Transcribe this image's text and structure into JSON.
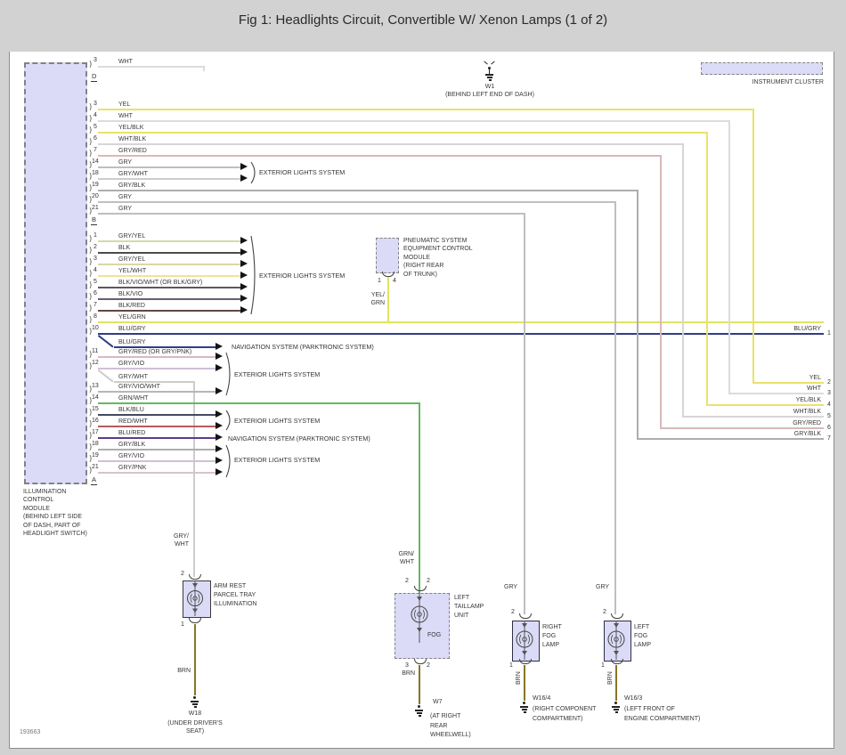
{
  "title": "Fig 1: Headlights Circuit, Convertible W/ Xenon Lamps (1 of 2)",
  "doc_id": "193663",
  "colors": {
    "page_bg": "#d2d2d2",
    "canvas": "#ffffff",
    "module_fill": "#dbdbf7",
    "YEL": "#e9e26b",
    "WHT": "#dcdcdc",
    "YEL_BLK": "#e9e26b",
    "WHT_BLK": "#d6d6d6",
    "GRY_RED": "#d8b9b9",
    "GRY": "#bfbfbf",
    "GRY_WHT": "#cdcdcd",
    "GRY_BLK": "#aeaeae",
    "GRY_YEL": "#d8d8a8",
    "BLK": "#4c4c4c",
    "YEL_WHT": "#ece594",
    "BLK_VIO_WHT": "#5d5663",
    "BLK_VIO": "#6d5c73",
    "BLK_RED": "#614747",
    "YEL_GRN": "#dfe55e",
    "BLU_GRY": "#303d85",
    "GRY_VIO": "#cfc0d6",
    "GRY_VIO_WHT": "#b6b6be",
    "GRN_WHT": "#63b863",
    "BLK_BLU": "#424a5e",
    "RED_WHT": "#b65b5b",
    "BLU_RED": "#5c3b8e",
    "GRY_PNK": "#d9c3cb",
    "BRN": "#8a7426"
  },
  "left_module": {
    "caption": "ILLUMINATION\nCONTROL\nMODULE\n(BEHIND LEFT SIDE\nOF DASH, PART OF\nHEADLIGHT SWITCH)",
    "connector_d": "D",
    "connector_b": "B",
    "connector_a": "A",
    "d_rows": [
      {
        "pin": "3",
        "label": "WHT"
      }
    ],
    "b_rows": [
      {
        "pin": "3",
        "label": "YEL"
      },
      {
        "pin": "4",
        "label": "WHT"
      },
      {
        "pin": "5",
        "label": "YEL/BLK"
      },
      {
        "pin": "6",
        "label": "WHT/BLK"
      },
      {
        "pin": "7",
        "label": "GRY/RED"
      },
      {
        "pin": "14",
        "label": "GRY"
      },
      {
        "pin": "18",
        "label": "GRY/WHT"
      },
      {
        "pin": "19",
        "label": "GRY/BLK"
      },
      {
        "pin": "20",
        "label": "GRY"
      },
      {
        "pin": "21",
        "label": "GRY"
      }
    ],
    "a_rows": [
      {
        "pin": "1",
        "label": "GRY/YEL"
      },
      {
        "pin": "2",
        "label": "BLK"
      },
      {
        "pin": "3",
        "label": "GRY/YEL"
      },
      {
        "pin": "4",
        "label": "YEL/WHT"
      },
      {
        "pin": "5",
        "label": "BLK/VIO/WHT (OR BLK/GRY)"
      },
      {
        "pin": "6",
        "label": "BLK/VIO"
      },
      {
        "pin": "7",
        "label": "BLK/RED"
      },
      {
        "pin": "8",
        "label": "YEL/GRN"
      },
      {
        "pin": "10",
        "label": "BLU/GRY"
      },
      {
        "pin": "11",
        "label": "GRY/RED (OR GRY/PNK)"
      },
      {
        "pin": "12",
        "label": "GRY/VIO"
      },
      {
        "pin": "13",
        "label": "GRY/VIO/WHT"
      },
      {
        "pin": "14",
        "label": "GRN/WHT"
      },
      {
        "pin": "15",
        "label": "BLK/BLU"
      },
      {
        "pin": "16",
        "label": "RED/WHT"
      },
      {
        "pin": "17",
        "label": "BLU/RED"
      },
      {
        "pin": "18",
        "label": "GRY/BLK"
      },
      {
        "pin": "19",
        "label": "GRY/VIO"
      },
      {
        "pin": "21",
        "label": "GRY/PNK"
      }
    ],
    "branch_blu_gry": "BLU/GRY",
    "branch_gry_wht": "GRY/WHT"
  },
  "systems": {
    "exterior": "EXTERIOR LIGHTS SYSTEM",
    "navigation": "NAVIGATION SYSTEM (PARKTRONIC SYSTEM)"
  },
  "right_pins": [
    {
      "num": "1",
      "label": "BLU/GRY"
    },
    {
      "num": "2",
      "label": "YEL"
    },
    {
      "num": "3",
      "label": "WHT"
    },
    {
      "num": "4",
      "label": "YEL/BLK"
    },
    {
      "num": "5",
      "label": "WHT/BLK"
    },
    {
      "num": "6",
      "label": "GRY/RED"
    },
    {
      "num": "7",
      "label": "GRY/BLK"
    }
  ],
  "instrument_cluster": {
    "label": "INSTRUMENT CLUSTER"
  },
  "pneumatic": {
    "caption": "PNEUMATIC SYSTEM\nEQUIPMENT CONTROL\nMODULE\n(RIGHT REAR\nOF TRUNK)",
    "pin_left": "1",
    "pin_right": "4",
    "wire": "YEL/\nGRN"
  },
  "armrest": {
    "label": "ARM REST\nPARCEL TRAY\nILLUMINATION",
    "pin_top": "2",
    "pin_bottom": "1",
    "wire_top": "GRY/\nWHT",
    "wire_bottom": "BRN"
  },
  "taillamp": {
    "label": "LEFT\nTAILLAMP\nUNIT",
    "bulb": "FOG",
    "pin_top_left": "2",
    "pin_top_right": "2",
    "pin_bottom_left": "3",
    "pin_bottom_right": "2",
    "wire_top": "GRN/\nWHT",
    "wire_bottom": "BRN"
  },
  "right_fog": {
    "label": "RIGHT\nFOG\nLAMP",
    "pin_top": "2",
    "pin_bottom": "1",
    "wire_top": "GRY",
    "wire_bottom": "BRN"
  },
  "left_fog": {
    "label": "LEFT\nFOG\nLAMP",
    "pin_top": "2",
    "pin_bottom": "1",
    "wire_top": "GRY",
    "wire_bottom": "BRN"
  },
  "grounds": {
    "w1": {
      "name": "W1",
      "loc": "(BEHIND LEFT END OF DASH)"
    },
    "w18": {
      "name": "W18",
      "loc": "(UNDER DRIVER'S\nSEAT)"
    },
    "w7": {
      "name": "W7",
      "loc": "(AT RIGHT\nREAR\nWHEELWELL)"
    },
    "w16_4": {
      "name": "W16/4",
      "loc": "(RIGHT COMPONENT\nCOMPARTMENT)"
    },
    "w16_3": {
      "name": "W16/3",
      "loc": "(LEFT FRONT OF\nENGINE COMPARTMENT)"
    }
  }
}
